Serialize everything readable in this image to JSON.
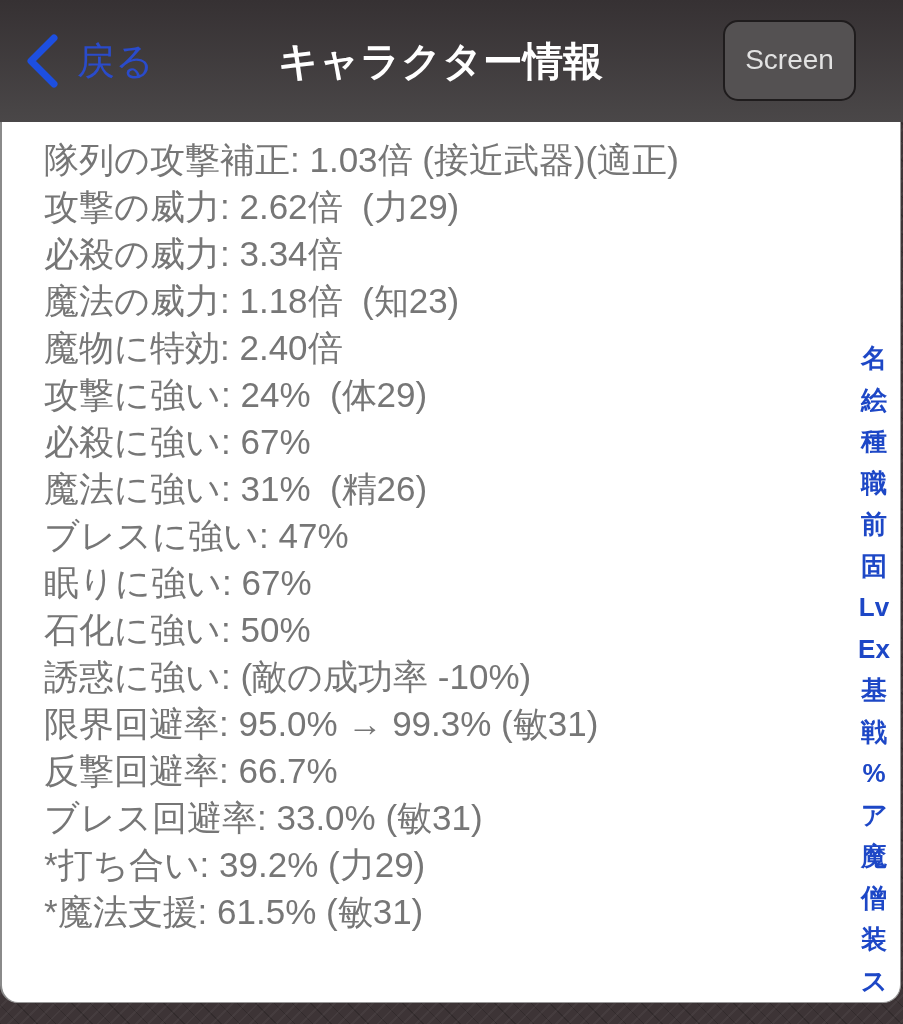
{
  "nav_bar": {
    "back_button": "戻る",
    "title": "キャラクター情報",
    "screen_button": "Screen"
  },
  "stats": [
    "隊列の攻撃補正: 1.03倍 (接近武器)(適正)",
    "攻撃の威力: 2.62倍  (力29)",
    "必殺の威力: 3.34倍",
    "魔法の威力: 1.18倍  (知23)",
    "魔物に特効: 2.40倍",
    "攻撃に強い: 24%  (体29)",
    "必殺に強い: 67%",
    "魔法に強い: 31%  (精26)",
    "ブレスに強い: 47%",
    "眠りに強い: 67%",
    "石化に強い: 50%",
    "誘惑に強い: (敵の成功率 -10%)",
    "限界回避率: 95.0% → 99.3% (敏31)",
    "反撃回避率: 66.7%",
    "ブレス回避率: 33.0% (敏31)",
    "*打ち合い: 39.2% (力29)",
    "*魔法支援: 61.5% (敏31)"
  ],
  "section_index": [
    "名",
    "絵",
    "種",
    "職",
    "前",
    "固",
    "Lv",
    "Ex",
    "基",
    "戦",
    "%",
    "ア",
    "魔",
    "僧",
    "装",
    "ス"
  ]
}
